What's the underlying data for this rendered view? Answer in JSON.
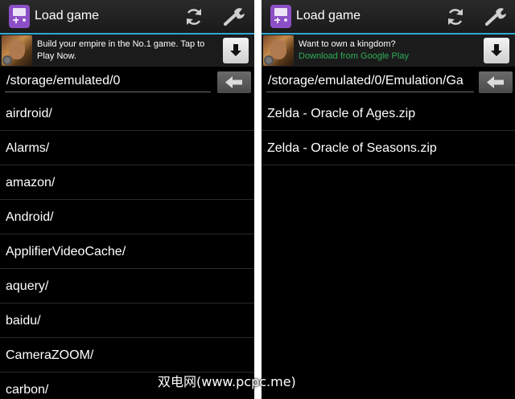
{
  "left": {
    "title": "Load game",
    "ad": {
      "text": "Build your empire in the No.1 game. Tap to Play Now.",
      "sub": ""
    },
    "path": "/storage/emulated/0",
    "items": [
      "airdroid/",
      "Alarms/",
      "amazon/",
      "Android/",
      "ApplifierVideoCache/",
      "aquery/",
      "baidu/",
      "CameraZOOM/",
      "carbon/"
    ]
  },
  "right": {
    "title": "Load game",
    "ad": {
      "text": "Want to own a kingdom?",
      "sub": "Download from Google Play"
    },
    "path": "/storage/emulated/0/Emulation/Ga",
    "items": [
      "Zelda - Oracle of Ages.zip",
      "Zelda - Oracle of Seasons.zip"
    ]
  },
  "icons": [
    "gameboy-app-icon",
    "refresh-icon",
    "wrench-icon",
    "download-icon",
    "back-arrow-icon"
  ],
  "colors": {
    "accent": "#2fa8d5",
    "background": "#000000",
    "ad_link": "#2fae5a",
    "app_icon": "#8c4fc6"
  },
  "watermark": "双电网(www.pcpc.me)"
}
